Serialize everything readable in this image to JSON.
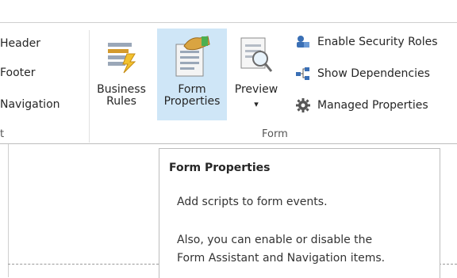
{
  "left_group": {
    "items": [
      "Header",
      "Footer",
      "Navigation"
    ],
    "group_label": "t"
  },
  "form_group": {
    "label": "Form",
    "business_rules": {
      "line1": "Business",
      "line2": "Rules"
    },
    "form_properties": {
      "line1": "Form",
      "line2": "Properties"
    },
    "preview": {
      "label": "Preview",
      "arrow": "▾"
    },
    "small_buttons": [
      {
        "label": "Enable Security Roles",
        "icon": "security-roles-icon"
      },
      {
        "label": "Show Dependencies",
        "icon": "dependencies-icon"
      },
      {
        "label": "Managed Properties",
        "icon": "gear-icon"
      }
    ]
  },
  "tooltip": {
    "title": "Form Properties",
    "line1": "Add scripts to form events.",
    "line2": "Also, you can enable or disable the",
    "line3": "Form Assistant and Navigation items."
  },
  "colors": {
    "selected_bg": "#cfe6f7",
    "accent_blue": "#2b6cb0"
  }
}
